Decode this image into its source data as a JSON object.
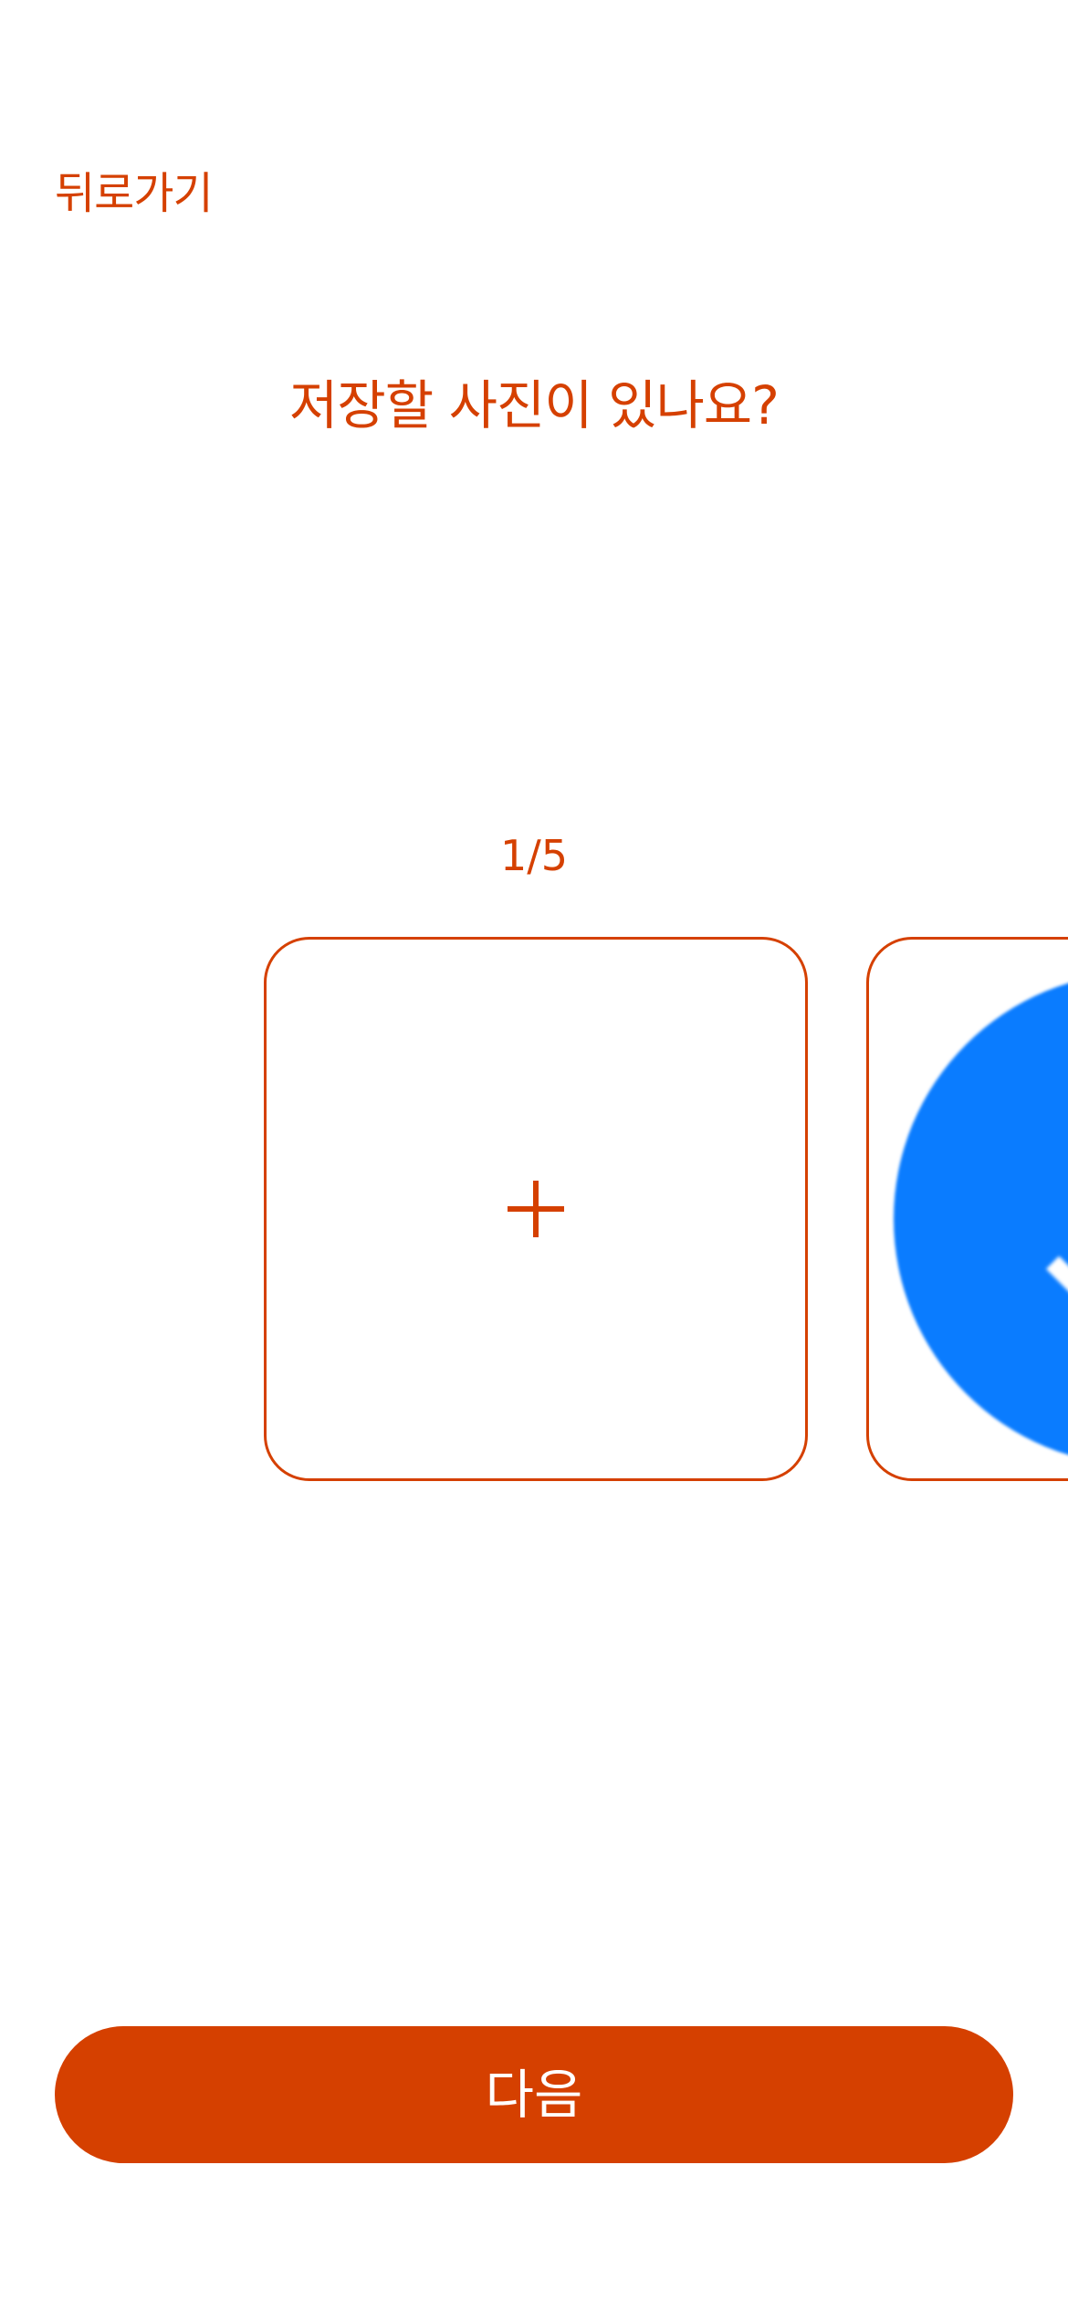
{
  "header": {
    "back_label": "뒤로가기"
  },
  "main": {
    "question": "저장할 사진이 있나요?",
    "counter": "1/5",
    "slots": [
      {
        "type": "add",
        "icon": "plus-icon"
      },
      {
        "type": "photo",
        "icon": "blue-check-circle-icon"
      }
    ]
  },
  "footer": {
    "next_label": "다음"
  },
  "colors": {
    "accent": "#D54000",
    "button_text": "#FFFFFF",
    "photo_blue": "#0A7CFF",
    "background": "#FFFFFF"
  }
}
